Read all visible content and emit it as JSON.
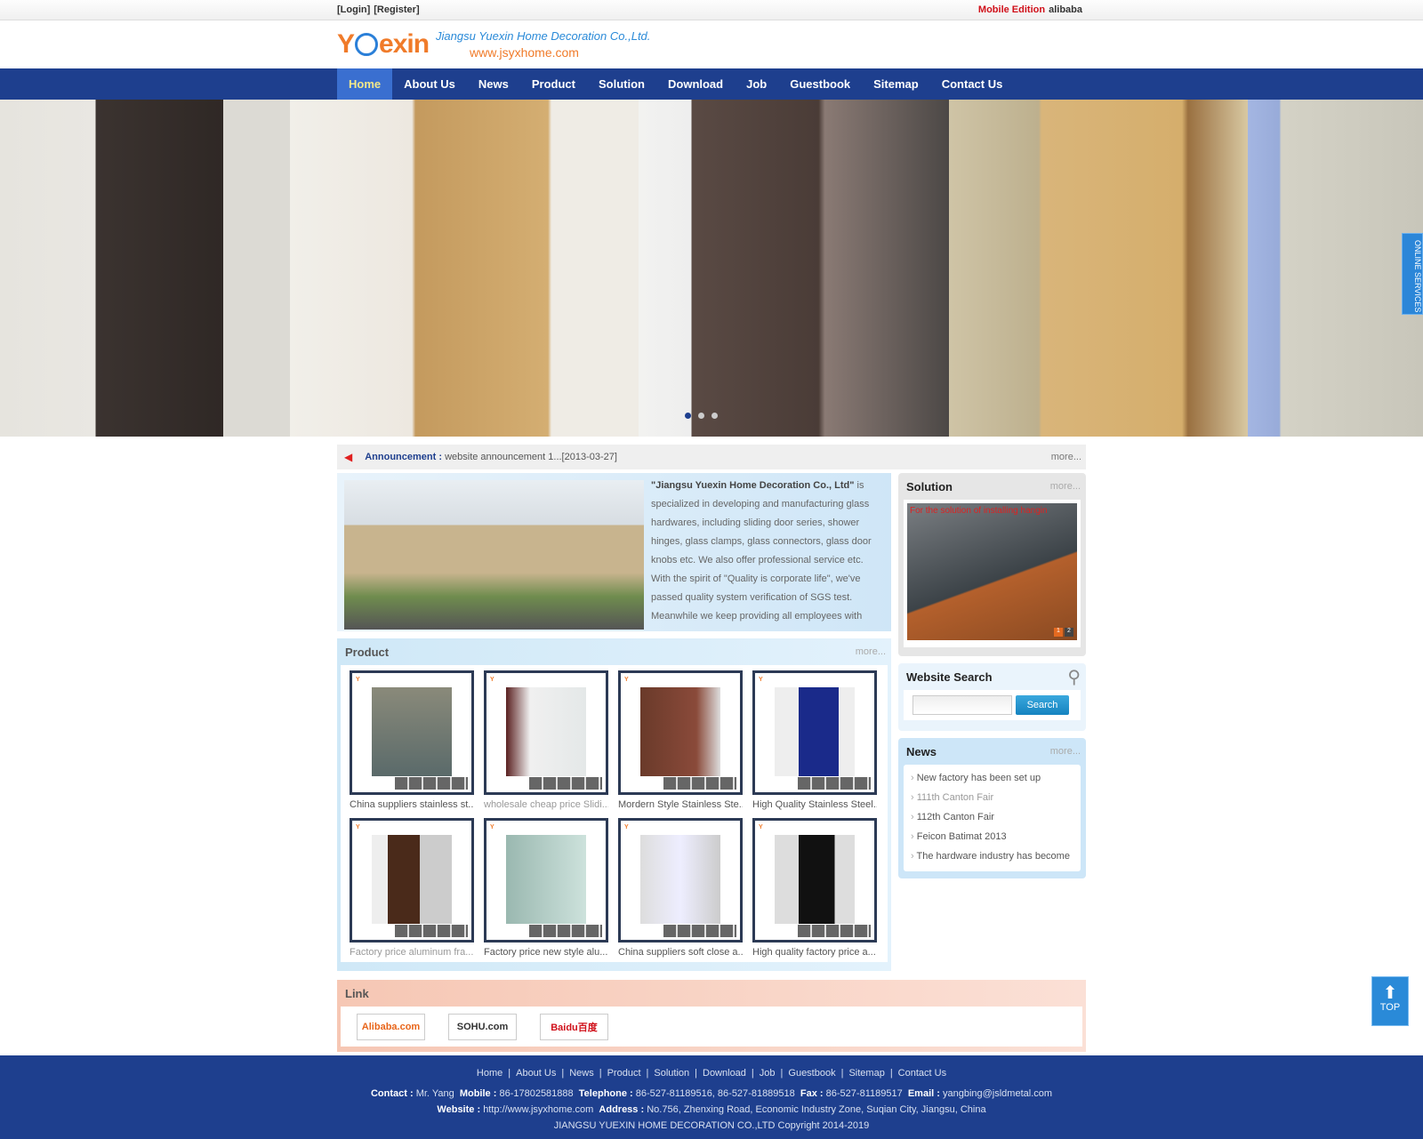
{
  "topbar": {
    "login": "[Login]",
    "register": "[Register]",
    "mobile": "Mobile Edition",
    "alibaba": "alibaba"
  },
  "header": {
    "logo": "Yuexin",
    "company": "Jiangsu Yuexin Home Decoration Co.,Ltd.",
    "url": "www.jsyxhome.com"
  },
  "nav": [
    "Home",
    "About Us",
    "News",
    "Product",
    "Solution",
    "Download",
    "Job",
    "Guestbook",
    "Sitemap",
    "Contact Us"
  ],
  "banner": {
    "service_tab": "ONLINE SERVICES",
    "slides": 3,
    "active": 1
  },
  "announcement": {
    "label": "Announcement :",
    "text": "website announcement 1...[2013-03-27]",
    "more": "more..."
  },
  "about": {
    "company": "\"Jiangsu Yuexin Home Decoration Co., Ltd\"",
    "text": " is specialized in developing and manufacturing glass hardwares, including sliding door series, shower hinges, glass clamps, glass connectors, glass door knobs etc. We also offer professional service etc. With the spirit of \"Quality is corporate life\", we've passed quality system verification of SGS test. Meanwhile we keep providing all employees with"
  },
  "product": {
    "title": "Product",
    "more": "more...",
    "items": [
      "China suppliers stainless st...",
      "wholesale cheap price Slidi...",
      "Mordern Style Stainless Ste..",
      "High Quality Stainless Steel...",
      "Factory price aluminum fra...",
      "Factory price new style alu...",
      "China suppliers soft close a..",
      "High quality factory price a..."
    ]
  },
  "solution": {
    "title": "Solution",
    "more": "more...",
    "caption": "For the solution of installing hangin",
    "pages": [
      "1",
      "2"
    ]
  },
  "search": {
    "title": "Website Search",
    "placeholder": "",
    "button": "Search"
  },
  "news": {
    "title": "News",
    "more": "more...",
    "items": [
      "New factory has been set up",
      "111th Canton Fair",
      "112th Canton Fair",
      "Feicon Batimat 2013",
      "The hardware industry has become"
    ]
  },
  "link": {
    "title": "Link",
    "items": [
      "Alibaba.com",
      "SOHU.com",
      "Baidu百度"
    ]
  },
  "footer": {
    "links": [
      "Home",
      "About Us",
      "News",
      "Product",
      "Solution",
      "Download",
      "Job",
      "Guestbook",
      "Sitemap",
      "Contact Us"
    ],
    "contact_label": "Contact :",
    "contact": "Mr. Yang",
    "mobile_label": "Mobile :",
    "mobile": "86-17802581888",
    "tel_label": "Telephone :",
    "tel": "86-527-81189516, 86-527-81889518",
    "fax_label": "Fax :",
    "fax": "86-527-81189517",
    "email_label": "Email :",
    "email": "yangbing@jsldmetal.com",
    "website_label": "Website :",
    "website": "http://www.jsyxhome.com",
    "address_label": "Address :",
    "address": "No.756, Zhenxing Road, Economic Industry Zone, Suqian City, Jiangsu, China",
    "copyright": "JIANGSU YUEXIN HOME DECORATION CO.,LTD  Copyright 2014-2019"
  },
  "top_button": "TOP"
}
